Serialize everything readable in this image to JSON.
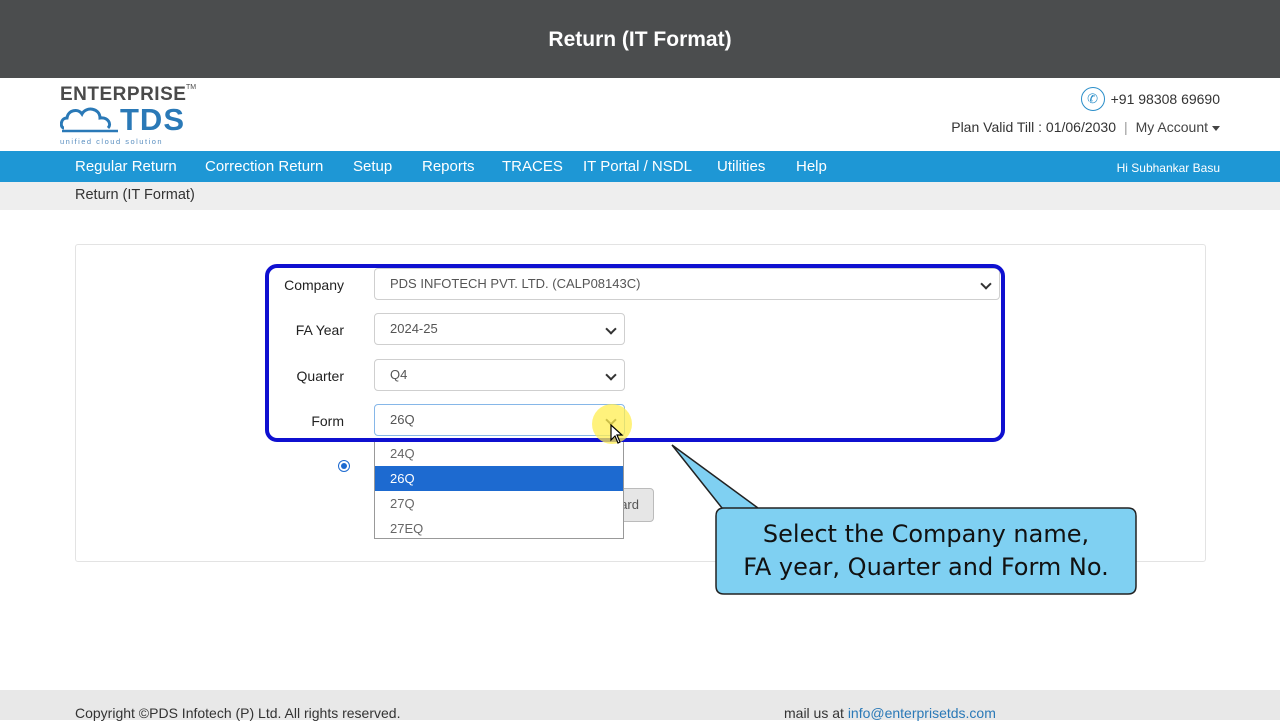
{
  "window": {
    "title": "Return (IT Format)"
  },
  "brand": {
    "name": "ENTERPRISE",
    "trademark": "TM",
    "product": "TDS",
    "tagline": "unified cloud solution"
  },
  "header": {
    "phone": "+91 98308 69690",
    "plan_label": "Plan Valid Till : 01/06/2030",
    "separator": "|",
    "account_label": "My Account"
  },
  "nav": {
    "items": [
      "Regular Return",
      "Correction Return",
      "Setup",
      "Reports",
      "TRACES",
      "IT Portal / NSDL",
      "Utilities",
      "Help"
    ],
    "greeting": "Hi Subhankar Basu"
  },
  "breadcrumb": "Return (IT Format)",
  "form": {
    "company": {
      "label": "Company",
      "value": "PDS INFOTECH PVT. LTD. (CALP08143C)"
    },
    "fa_year": {
      "label": "FA Year",
      "value": "2024-25"
    },
    "quarter": {
      "label": "Quarter",
      "value": "Q4"
    },
    "form_no": {
      "label": "Form",
      "value": "26Q",
      "options": [
        "24Q",
        "26Q",
        "27Q",
        "27EQ"
      ],
      "highlighted": "26Q"
    },
    "partial_button": "ard"
  },
  "callout": {
    "line1": "Select the Company name,",
    "line2": "FA year, Quarter and Form No."
  },
  "footer": {
    "copyright": "Copyright ©PDS Infotech (P) Ltd. All rights reserved.",
    "mail_prefix": "mail us at",
    "mail_link": "info@enterprisetds.com"
  },
  "colors": {
    "nav_bg": "#1e97d5",
    "titlebar_bg": "#4b4d4e",
    "highlight_border": "#0f10d0",
    "callout_bg": "#7fd0f2",
    "selected_option": "#1d6ad0"
  }
}
